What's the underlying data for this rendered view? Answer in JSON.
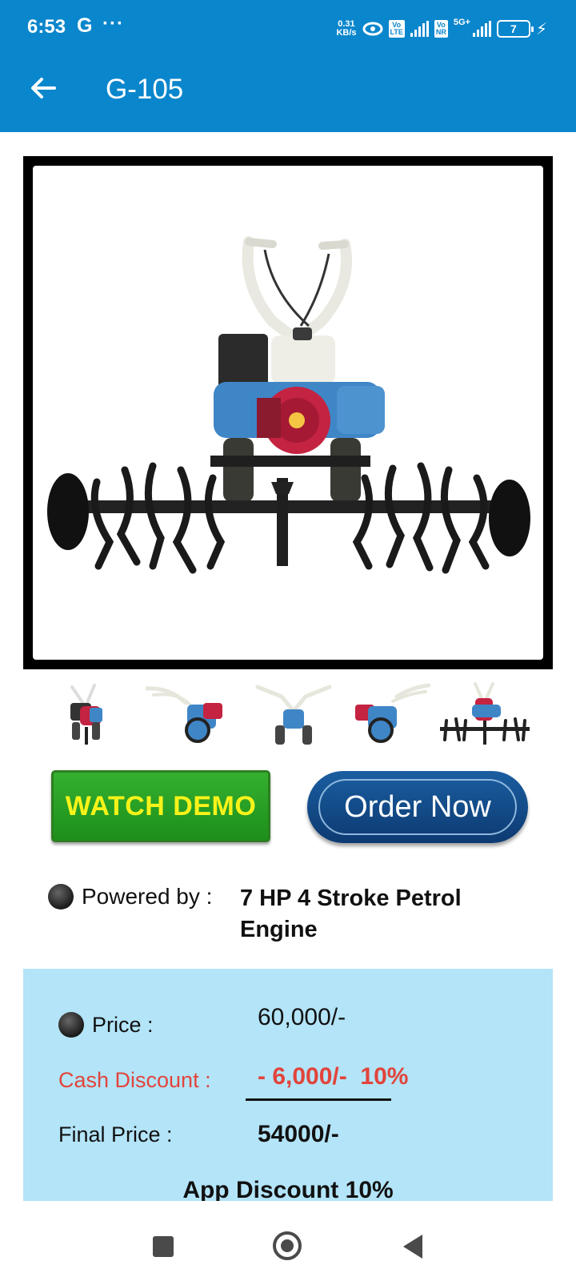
{
  "status_bar": {
    "time": "6:53",
    "google_badge": "G",
    "more_dots": "···",
    "net_speed_value": "0.31",
    "net_speed_unit": "KB/s",
    "sim1_tag_top": "Vo",
    "sim1_tag_bottom": "LTE",
    "sim2_tag_top": "Vo",
    "sim2_tag_bottom": "NR",
    "network_type": "5G+",
    "battery_level": "7",
    "colors": {
      "background": "#0a86cc",
      "foreground": "#ffffff"
    }
  },
  "app_bar": {
    "title": "G-105",
    "back_icon": "arrow-left-icon",
    "color": "#0a86cc"
  },
  "product": {
    "main_image": "power-tiller-rotavator-front-view",
    "thumbnails": [
      "tiller-front-view",
      "tiller-side-view",
      "tiller-rear-view",
      "tiller-side-view-2",
      "tiller-with-rotavator"
    ],
    "actions": {
      "watch_demo": "WATCH DEMO",
      "order_now": "Order Now"
    },
    "powered_by_label": "Powered by :",
    "powered_by_value": "7 HP 4 Stroke Petrol Engine"
  },
  "pricing": {
    "price_label": "Price :",
    "price_value": "60,000/-",
    "cash_discount_label": "Cash Discount :",
    "cash_discount_value": "- 6,000/-  10%",
    "final_price_label": "Final Price :",
    "final_price_value": "54000/-",
    "app_discount": "App Discount 10%",
    "colors": {
      "panel": "#b3e4f8",
      "discount": "#e2443b"
    }
  },
  "nav_bar": {
    "recents_icon": "square-icon",
    "home_icon": "circle-home-icon",
    "back_icon": "triangle-back-icon"
  }
}
